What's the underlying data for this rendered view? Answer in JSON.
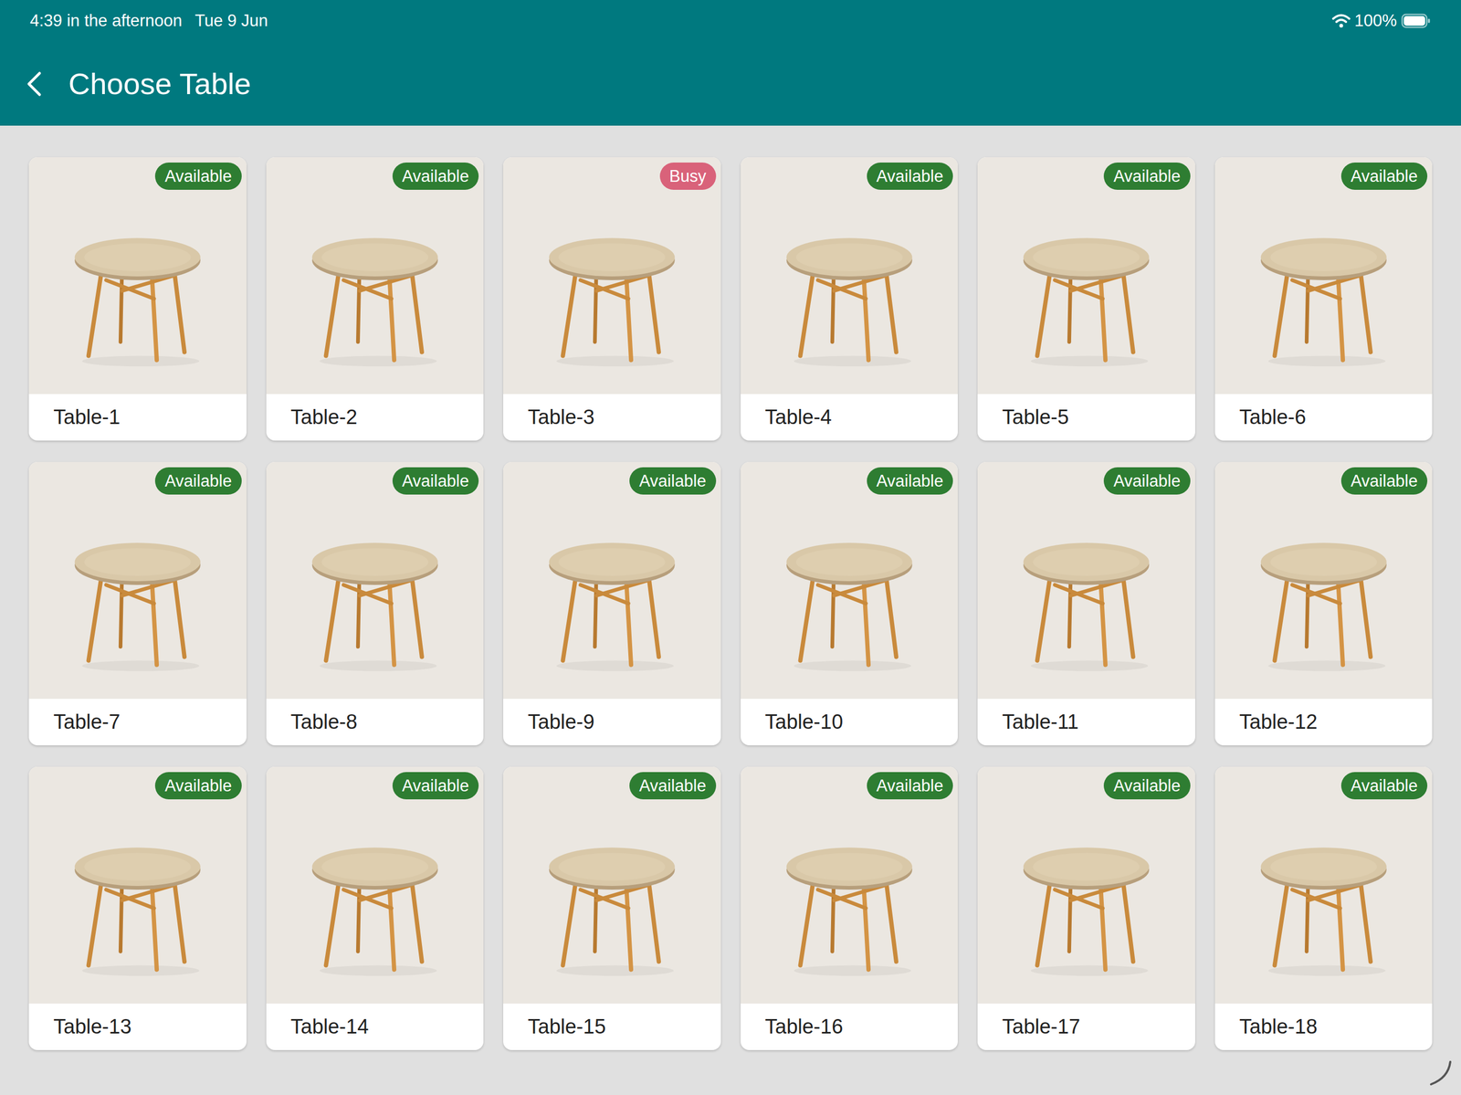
{
  "status_bar": {
    "time": "4:39 in the afternoon",
    "date": "Tue 9 Jun",
    "battery": "100%"
  },
  "app_bar": {
    "title": "Choose Table"
  },
  "tables": [
    {
      "label": "Table-1",
      "status": "Available",
      "color": "#2e7d32"
    },
    {
      "label": "Table-2",
      "status": "Available",
      "color": "#2e7d32"
    },
    {
      "label": "Table-3",
      "status": "Busy",
      "color": "#d9627a"
    },
    {
      "label": "Table-4",
      "status": "Available",
      "color": "#2e7d32"
    },
    {
      "label": "Table-5",
      "status": "Available",
      "color": "#2e7d32"
    },
    {
      "label": "Table-6",
      "status": "Available",
      "color": "#2e7d32"
    },
    {
      "label": "Table-7",
      "status": "Available",
      "color": "#2e7d32"
    },
    {
      "label": "Table-8",
      "status": "Available",
      "color": "#2e7d32"
    },
    {
      "label": "Table-9",
      "status": "Available",
      "color": "#2e7d32"
    },
    {
      "label": "Table-10",
      "status": "Available",
      "color": "#2e7d32"
    },
    {
      "label": "Table-11",
      "status": "Available",
      "color": "#2e7d32"
    },
    {
      "label": "Table-12",
      "status": "Available",
      "color": "#2e7d32"
    },
    {
      "label": "Table-13",
      "status": "Available",
      "color": "#2e7d32"
    },
    {
      "label": "Table-14",
      "status": "Available",
      "color": "#2e7d32"
    },
    {
      "label": "Table-15",
      "status": "Available",
      "color": "#2e7d32"
    },
    {
      "label": "Table-16",
      "status": "Available",
      "color": "#2e7d32"
    },
    {
      "label": "Table-17",
      "status": "Available",
      "color": "#2e7d32"
    },
    {
      "label": "Table-18",
      "status": "Available",
      "color": "#2e7d32"
    }
  ]
}
